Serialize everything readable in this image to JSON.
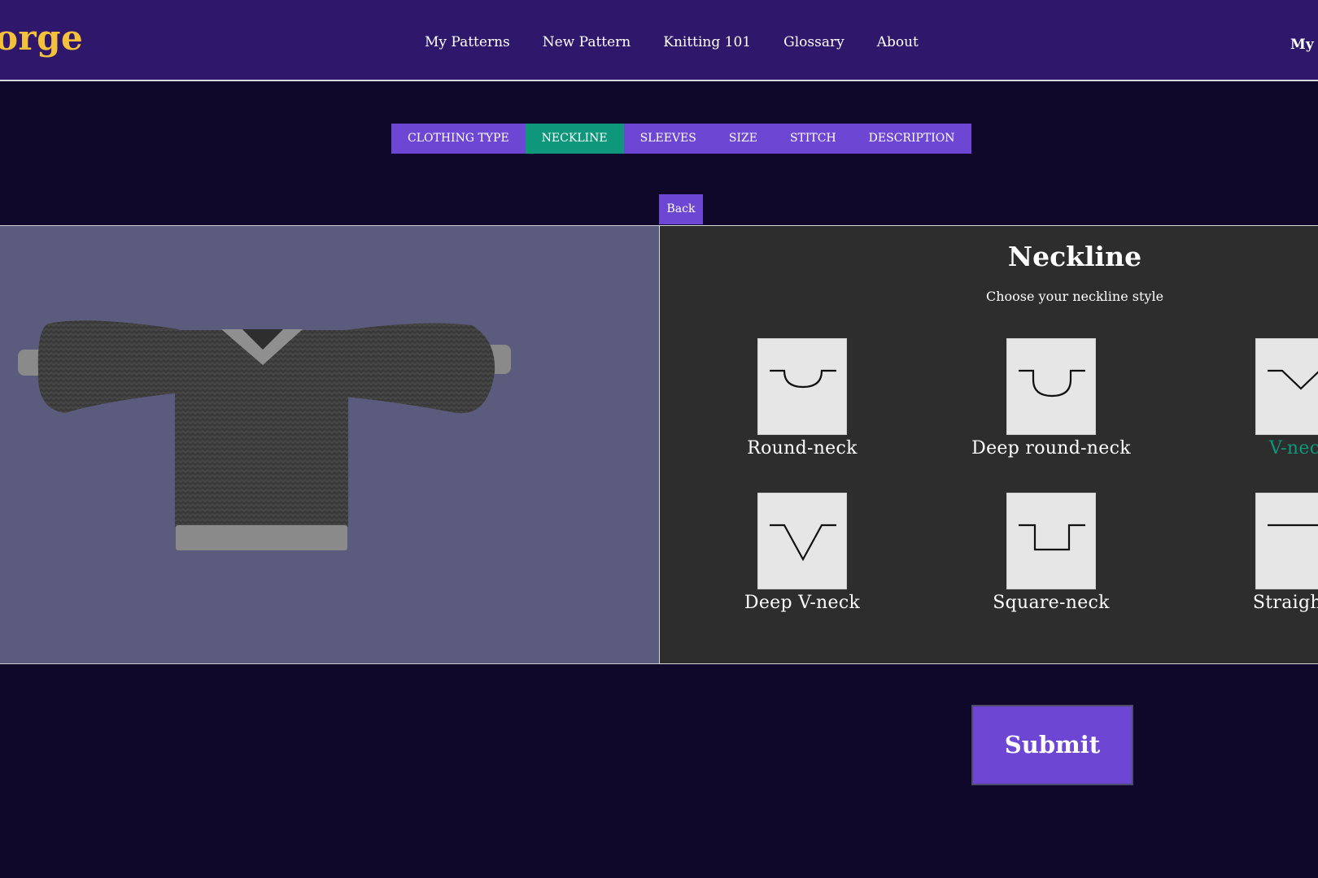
{
  "brand": {
    "logo_text": "orge",
    "logo_color": "#f3c13a"
  },
  "nav": {
    "items": [
      "My Patterns",
      "New Pattern",
      "Knitting 101",
      "Glossary",
      "About"
    ],
    "account": "My A"
  },
  "steps": {
    "items": [
      "Clothing Type",
      "Neckline",
      "Sleeves",
      "Size",
      "Stitch",
      "Description"
    ],
    "active_index": 1
  },
  "back_label": "Back",
  "panel": {
    "title": "Neckline",
    "subtitle": "Choose your neckline style",
    "options": [
      {
        "label": "Round-neck",
        "icon": "round-neck-icon"
      },
      {
        "label": "Deep round-neck",
        "icon": "deep-round-neck-icon"
      },
      {
        "label": "V-neck",
        "icon": "v-neck-icon",
        "selected": true
      },
      {
        "label": "Deep V-neck",
        "icon": "deep-v-neck-icon"
      },
      {
        "label": "Square-neck",
        "icon": "square-neck-icon"
      },
      {
        "label": "Straight-n",
        "icon": "straight-neck-icon"
      }
    ]
  },
  "submit_label": "Submit",
  "colors": {
    "background": "#10082a",
    "header": "#2f186b",
    "accent": "#6d46d4",
    "active_tab": "#0f977b",
    "preview_bg": "#5b5b7e",
    "panel_bg": "#2d2d2d"
  }
}
